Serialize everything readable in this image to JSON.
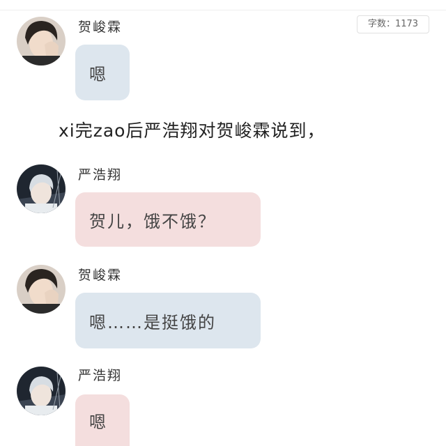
{
  "word_count": "字数：1173",
  "narration": "xi完zao后严浩翔对贺峻霖说到，",
  "messages": [
    {
      "speaker": "贺峻霖",
      "text": "嗯"
    },
    {
      "speaker": "严浩翔",
      "text": "贺儿，饿不饿？"
    },
    {
      "speaker": "贺峻霖",
      "text": "嗯……是挺饿的"
    },
    {
      "speaker": "严浩翔",
      "text": "嗯"
    }
  ],
  "colors": {
    "bubble_blue": "#dde6ee",
    "bubble_pink": "#f4dede",
    "background": "#ffffff"
  }
}
